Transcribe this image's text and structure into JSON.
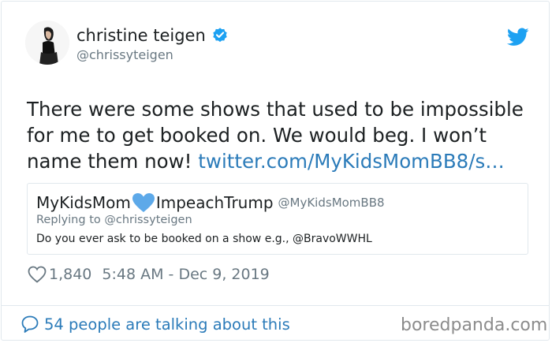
{
  "author": {
    "name": "christine teigen",
    "handle": "@chrissyteigen",
    "verified": true,
    "avatar_icon": "avatar-photo"
  },
  "tweet": {
    "lines": [
      "There were some shows that used to be impossible",
      "for me to get booked on. We would beg. I won’t",
      "name them now! "
    ],
    "link_text": "twitter.com/MyKidsMomBB8/s…"
  },
  "quote": {
    "name_part1": "MyKidsMom",
    "name_part2": "ImpeachTrump",
    "handle": "@MyKidsMomBB8",
    "reply_to": "Replying to @chrissyteigen",
    "text": "Do you ever ask to be booked on a show e.g., @BravoWWHL"
  },
  "meta": {
    "likes": "1,840",
    "timestamp": "5:48 AM - Dec 9, 2019"
  },
  "footer": {
    "talking": "54 people are talking about this",
    "watermark": "boredpanda.com"
  },
  "colors": {
    "link": "#2b7bb9",
    "verified": "#1da1f2",
    "blue_heart": "#5da9e9",
    "muted": "#697882"
  }
}
